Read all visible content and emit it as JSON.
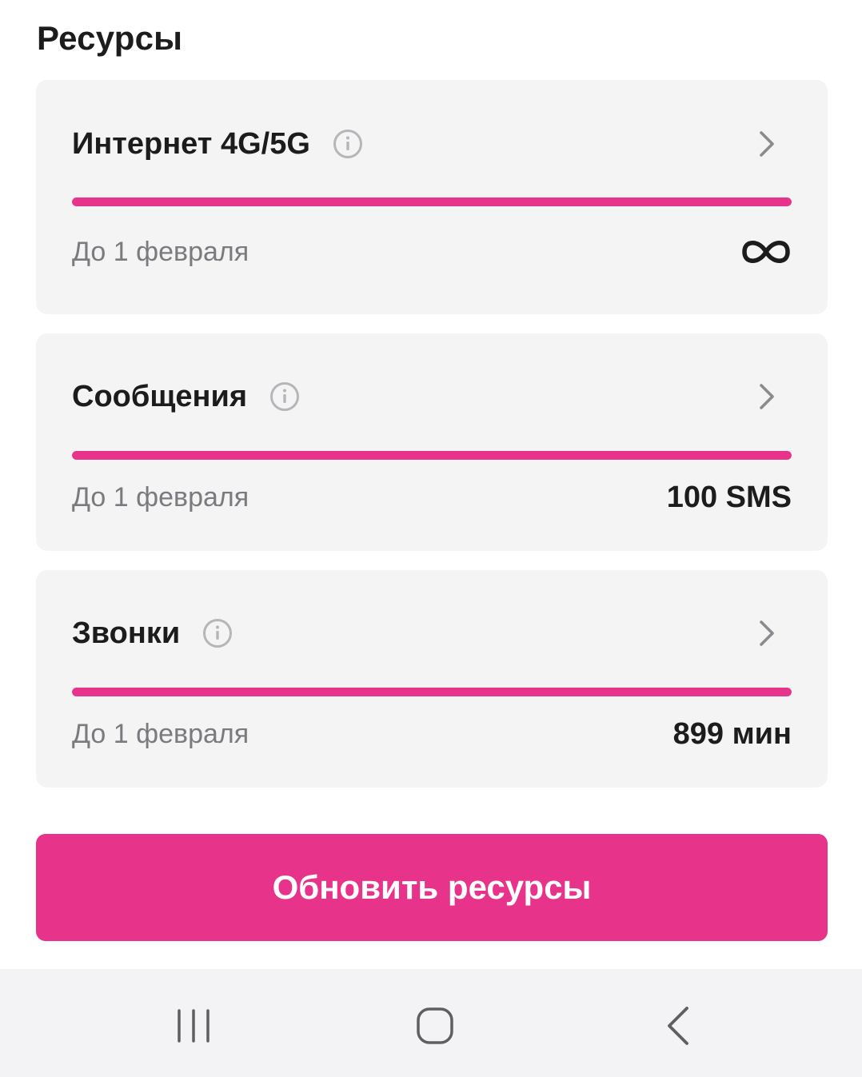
{
  "section": {
    "title": "Ресурсы"
  },
  "resources": [
    {
      "title": "Интернет 4G/5G",
      "date": "До 1 февраля",
      "value": "",
      "value_icon": "infinity-icon",
      "progress": 1.0
    },
    {
      "title": "Сообщения",
      "date": "До 1 февраля",
      "value": "100 SMS",
      "progress": 1.0
    },
    {
      "title": "Звонки",
      "date": "До 1 февраля",
      "value": "899 мин",
      "progress": 1.0
    }
  ],
  "actions": {
    "refresh_label": "Обновить ресурсы"
  },
  "nav": {
    "items": [
      "recents-icon",
      "home-icon",
      "back-icon"
    ]
  },
  "colors": {
    "accent": "#e8338b",
    "card_bg": "#f4f4f5",
    "muted_text": "#7a7a7f"
  }
}
